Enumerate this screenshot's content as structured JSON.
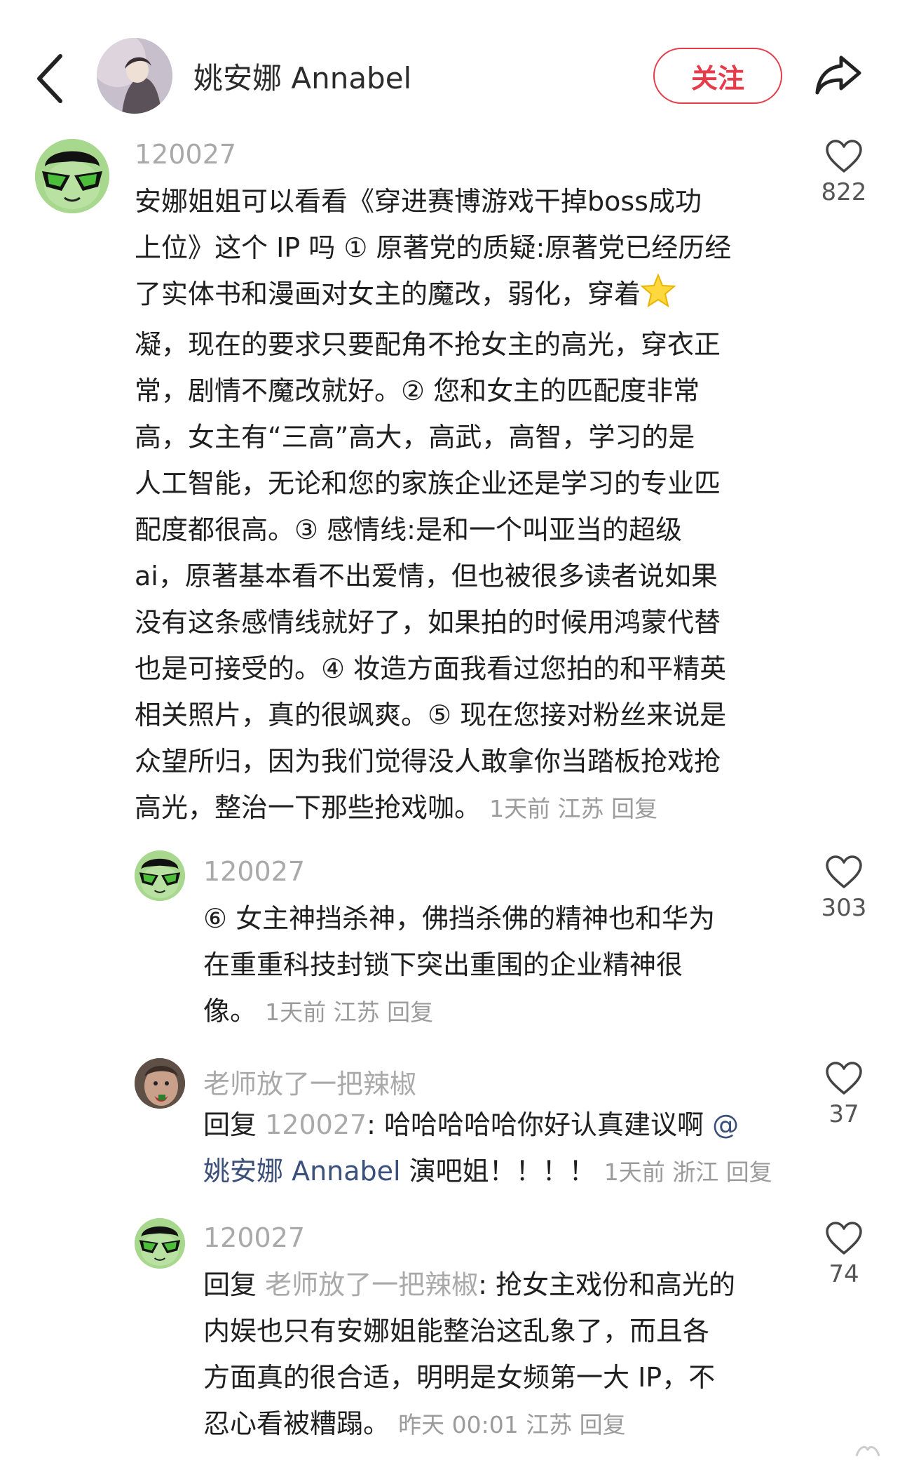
{
  "header": {
    "back_icon": "chevron-left-icon",
    "name": "姚安娜 Annabel",
    "follow_label": "关注",
    "share_icon": "share-arrow-icon",
    "accent_color": "#e63b4b"
  },
  "comments": [
    {
      "username": "120027",
      "text_lines": [
        "安娜姐姐可以看看《穿进赛博游戏干掉boss成功",
        "上位》这个 IP 吗 ① 原著党的质疑:原著党已经历经",
        "了实体书和漫画对女主的魔改，弱化，穿着",
        "凝，现在的要求只要配角不抢女主的高光，穿衣正",
        "常，剧情不魔改就好。② 您和女主的匹配度非常",
        "高，女主有“三高”高大，高武，高智，学习的是",
        "人工智能，无论和您的家族企业还是学习的专业匹",
        "配度都很高。③ 感情线:是和一个叫亚当的超级",
        "ai，原著基本看不出爱情，但也被很多读者说如果",
        "没有这条感情线就好了，如果拍的时候用鸿蒙代替",
        "也是可接受的。④ 妆造方面我看过您拍的和平精英",
        "相关照片，真的很飒爽。⑤ 现在您接对粉丝来说是",
        "众望所归，因为我们觉得没人敢拿你当踏板抢戏抢",
        "高光，整治一下那些抢戏咖。"
      ],
      "meta": "1天前 江苏 回复",
      "likes": "822"
    },
    {
      "username": "120027",
      "text_lines": [
        "⑥ 女主神挡杀神，佛挡杀佛的精神也和华为",
        "在重重科技封锁下突出重围的企业精神很",
        "像。"
      ],
      "meta": "1天前 江苏 回复",
      "likes": "303"
    },
    {
      "username": "老师放了一把辣椒",
      "reply_prefix": "回复",
      "reply_target": "120027",
      "line1_text": ": 哈哈哈哈哈你好认真建议啊",
      "mention_part1": "@",
      "mention_part2": "姚安娜 Annabel",
      "line2_text": " 演吧姐！！！！",
      "meta": "1天前 浙江 回复",
      "likes": "37"
    },
    {
      "username": "120027",
      "reply_prefix": "回复",
      "reply_target": "老师放了一把辣椒",
      "line1_text": ": 抢女主戏份和高光的",
      "text_lines": [
        "内娱也只有安娜姐能整治这乱象了，而且各",
        "方面真的很合适，明明是女频第一大 IP，不",
        "忍心看被糟蹋。"
      ],
      "meta": "昨天 00:01 江苏 回复",
      "likes": "74"
    }
  ]
}
